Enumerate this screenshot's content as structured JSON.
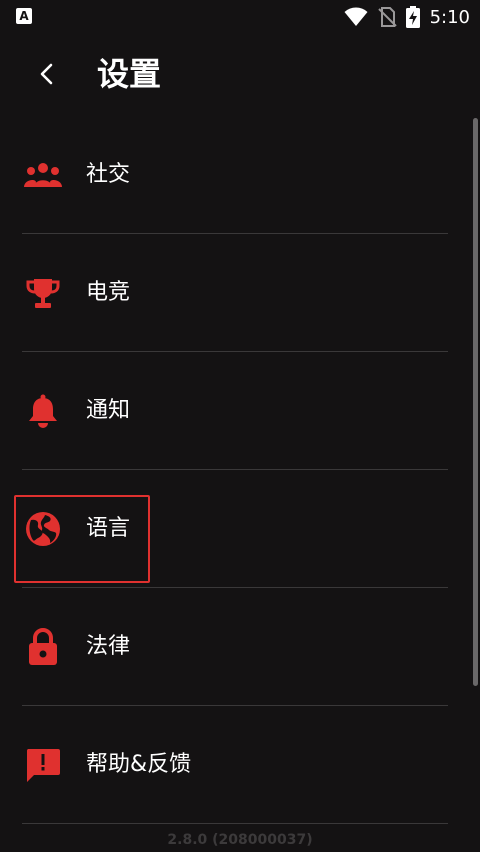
{
  "status_bar": {
    "app_icon_letter": "A",
    "time": "5:10"
  },
  "header": {
    "title": "设置"
  },
  "settings": {
    "items": [
      {
        "label": "社交",
        "icon": "people-group-icon"
      },
      {
        "label": "电竞",
        "icon": "trophy-icon"
      },
      {
        "label": "通知",
        "icon": "bell-icon"
      },
      {
        "label": "语言",
        "icon": "globe-icon"
      },
      {
        "label": "法律",
        "icon": "lock-icon"
      },
      {
        "label": "帮助&反馈",
        "icon": "feedback-message-icon"
      }
    ]
  },
  "footer": {
    "version": "2.8.0 (208000037)"
  },
  "colors": {
    "background": "#141213",
    "accent": "#e0312f",
    "divider": "#3a3839",
    "highlight": "#e0312f"
  }
}
